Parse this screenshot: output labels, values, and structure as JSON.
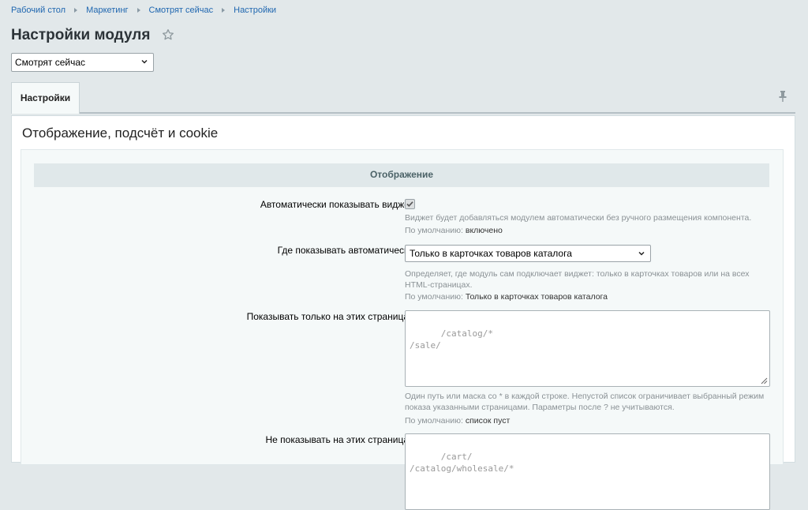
{
  "breadcrumb": [
    "Рабочий стол",
    "Маркетинг",
    "Смотрят сейчас",
    "Настройки"
  ],
  "page_title": "Настройки модуля",
  "module_select": {
    "value": "Смотрят сейчас"
  },
  "tabs": [
    {
      "label": "Настройки",
      "active": true
    }
  ],
  "section_title": "Отображение, подсчёт и cookie",
  "group_header": "Отображение",
  "default_prefix": "По умолчанию:",
  "options": {
    "auto_show": {
      "label": "Автоматически показывать виджет",
      "checked": true,
      "hint": "Виджет будет добавляться модулем автоматически без ручного размещения компонента.",
      "default": "включено"
    },
    "where_auto": {
      "label": "Где показывать автоматически",
      "value": "Только в карточках товаров каталога",
      "hint": "Определяет, где модуль сам подключает виджет: только в карточках товаров или на всех HTML-страницах.",
      "default": "Только в карточках товаров каталога"
    },
    "show_only": {
      "label": "Показывать только на этих страницах",
      "placeholder": "/catalog/*\n/sale/",
      "hint": "Один путь или маска со * в каждой строке. Непустой список ограничивает выбранный режим показа указанными страницами. Параметры после ? не учитываются.",
      "default": "список пуст"
    },
    "hide_on": {
      "label": "Не показывать на этих страницах",
      "placeholder": "/cart/\n/catalog/wholesale/*"
    }
  },
  "colors": {
    "link": "#2067b0",
    "header_bg": "#e0e8ea",
    "page_bg": "#e2e8ea"
  }
}
